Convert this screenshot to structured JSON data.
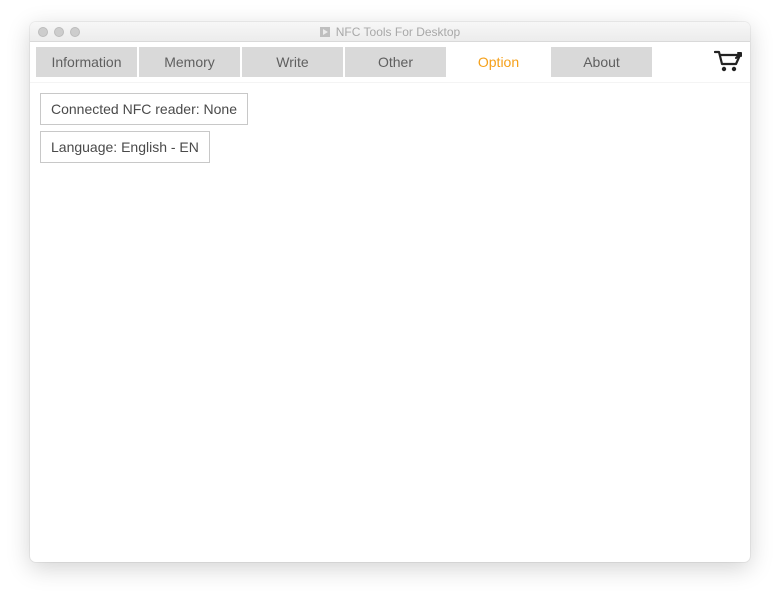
{
  "window": {
    "title": "NFC Tools For Desktop"
  },
  "tabs": [
    {
      "label": "Information",
      "active": false
    },
    {
      "label": "Memory",
      "active": false
    },
    {
      "label": "Write",
      "active": false
    },
    {
      "label": "Other",
      "active": false
    },
    {
      "label": "Option",
      "active": true
    },
    {
      "label": "About",
      "active": false
    }
  ],
  "options": {
    "nfc_reader": "Connected NFC reader: None",
    "language": "Language: English - EN"
  }
}
